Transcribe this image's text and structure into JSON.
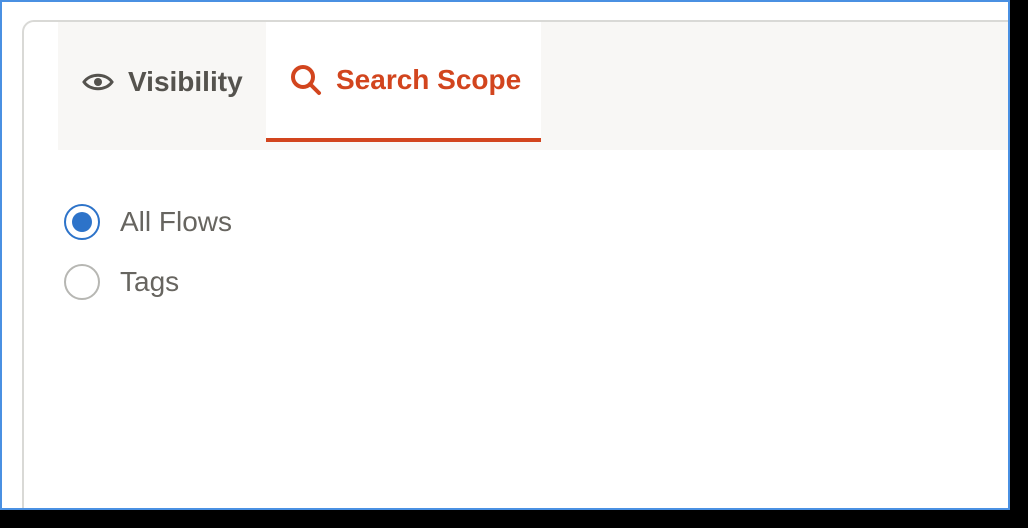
{
  "tabs": [
    {
      "label": "Visibility",
      "icon": "eye-icon",
      "active": false
    },
    {
      "label": "Search Scope",
      "icon": "search-icon",
      "active": true
    }
  ],
  "scope": {
    "options": [
      {
        "label": "All Flows",
        "selected": true
      },
      {
        "label": "Tags",
        "selected": false
      }
    ]
  },
  "colors": {
    "accent": "#d2451e",
    "radio_selected": "#2d73c9",
    "tab_text": "#55534e",
    "label_text": "#676560",
    "frame_border": "#4a90e2"
  }
}
